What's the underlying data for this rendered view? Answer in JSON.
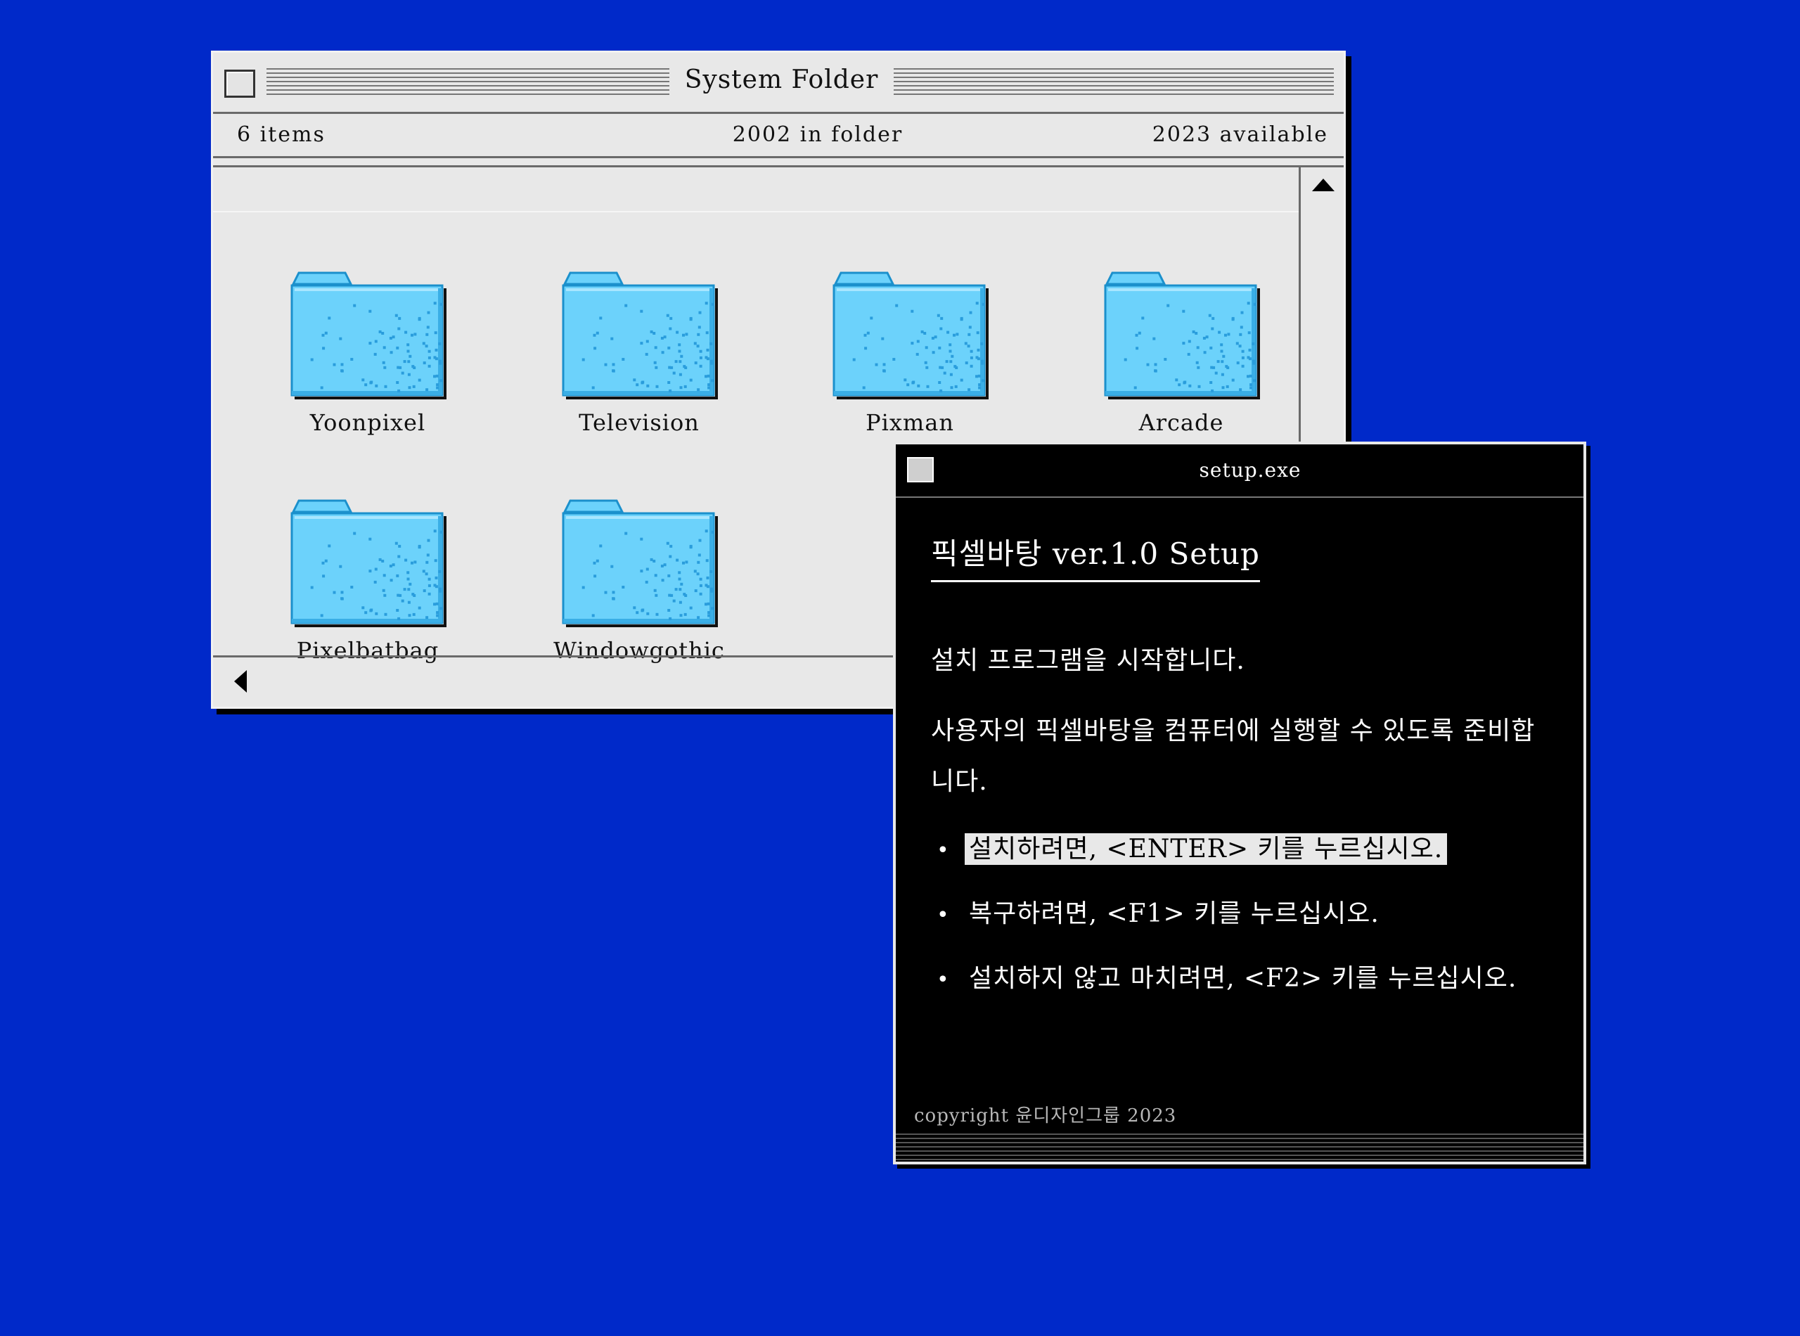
{
  "system_folder": {
    "title": "System Folder",
    "info": {
      "items": "6 items",
      "in_folder": "2002 in folder",
      "available": "2023 available"
    },
    "folders": [
      {
        "label": "Yoonpixel"
      },
      {
        "label": "Television"
      },
      {
        "label": "Pixman"
      },
      {
        "label": "Arcade"
      },
      {
        "label": "Pixelbatbag"
      },
      {
        "label": "Windowgothic"
      }
    ],
    "folder_colors": {
      "body": "#6cd2fb",
      "shadow": "#3aaee6",
      "outline": "#1b90cc",
      "dots": "#2a9ddc"
    }
  },
  "setup": {
    "title": "setup.exe",
    "heading": "픽셀바탕 ver.1.0 Setup",
    "line1": "설치 프로그램을 시작합니다.",
    "line2": "사용자의 픽셀바탕을 컴퓨터에 실행할 수 있도록 준비합니다.",
    "options": [
      {
        "label": "설치하려면, <ENTER> 키를 누르십시오.",
        "selected": true
      },
      {
        "label": "복구하려면, <F1> 키를 누르십시오.",
        "selected": false
      },
      {
        "label": "설치하지 않고 마치려면, <F2> 키를 누르십시오.",
        "selected": false
      }
    ],
    "copyright": "copyright  윤디자인그룹 2023"
  },
  "colors": {
    "desktop": "#0029c9",
    "window": "#e8e8e8",
    "setup_bg": "#000000"
  }
}
